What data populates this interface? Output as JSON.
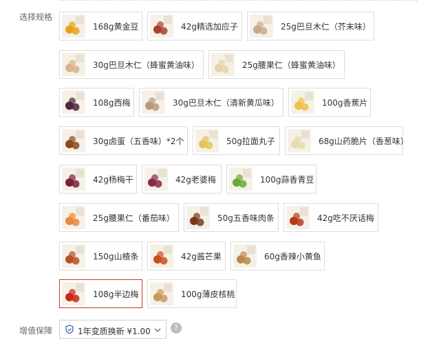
{
  "spec_label": "选择规格",
  "warranty": {
    "label": "增值保障",
    "option": "1年变质换新 ¥1.00",
    "help": "?"
  },
  "skus": [
    {
      "label": "168g黄金豆",
      "icon": "golden-bean-icon",
      "color": "#e8a21a",
      "selected": false
    },
    {
      "label": "42g精选加应子",
      "icon": "plum-icon",
      "color": "#a8402e",
      "selected": false
    },
    {
      "label": "25g巴旦木仁（芥末味）",
      "icon": "almond-icon",
      "color": "#c9a88a",
      "selected": false
    },
    {
      "label": "30g巴旦木仁（蜂蜜黄油味）",
      "icon": "almond-icon",
      "color": "#d8b48a",
      "selected": false
    },
    {
      "label": "25g腰果仁（蜂蜜黄油味）",
      "icon": "cashew-icon",
      "color": "#e6d3a8",
      "selected": false
    },
    {
      "label": "108g西梅",
      "icon": "prune-icon",
      "color": "#4a2a3a",
      "selected": false
    },
    {
      "label": "30g巴旦木仁（清新黄瓜味）",
      "icon": "almond-icon",
      "color": "#b89a7a",
      "selected": false
    },
    {
      "label": "100g香蕉片",
      "icon": "banana-chip-icon",
      "color": "#eec24a",
      "selected": false
    },
    {
      "label": "30g卤蛋（五香味）*2个",
      "icon": "braised-egg-icon",
      "color": "#8a4a1a",
      "selected": false
    },
    {
      "label": "50g拉面丸子",
      "icon": "noodle-ball-icon",
      "color": "#e6c35a",
      "selected": false
    },
    {
      "label": "68g山药脆片（香葱味）",
      "icon": "yam-chip-icon",
      "color": "#e8dcaa",
      "selected": false
    },
    {
      "label": "42g杨梅干",
      "icon": "bayberry-icon",
      "color": "#7a1e3a",
      "selected": false
    },
    {
      "label": "42g老婆梅",
      "icon": "plum-icon",
      "color": "#8a2a4a",
      "selected": false
    },
    {
      "label": "100g蒜香青豆",
      "icon": "green-pea-icon",
      "color": "#6aa838",
      "selected": false
    },
    {
      "label": "25g腰果仁（番茄味）",
      "icon": "cashew-icon",
      "color": "#e88a3a",
      "selected": false
    },
    {
      "label": "50g五香味肉条",
      "icon": "meat-strip-icon",
      "color": "#7a3a1a",
      "selected": false
    },
    {
      "label": "42g吃不厌话梅",
      "icon": "plum-icon",
      "color": "#b83a1a",
      "selected": false
    },
    {
      "label": "150g山楂条",
      "icon": "hawthorn-icon",
      "color": "#b8502a",
      "selected": false
    },
    {
      "label": "42g酱芒果",
      "icon": "mango-icon",
      "color": "#c8501a",
      "selected": false
    },
    {
      "label": "60g香辣小黄鱼",
      "icon": "fish-icon",
      "color": "#b88a4a",
      "selected": false
    },
    {
      "label": "108g半边梅",
      "icon": "half-plum-icon",
      "color": "#c8281a",
      "selected": true
    },
    {
      "label": "100g薄皮核桃",
      "icon": "walnut-icon",
      "color": "#c89a5a",
      "selected": false
    }
  ]
}
